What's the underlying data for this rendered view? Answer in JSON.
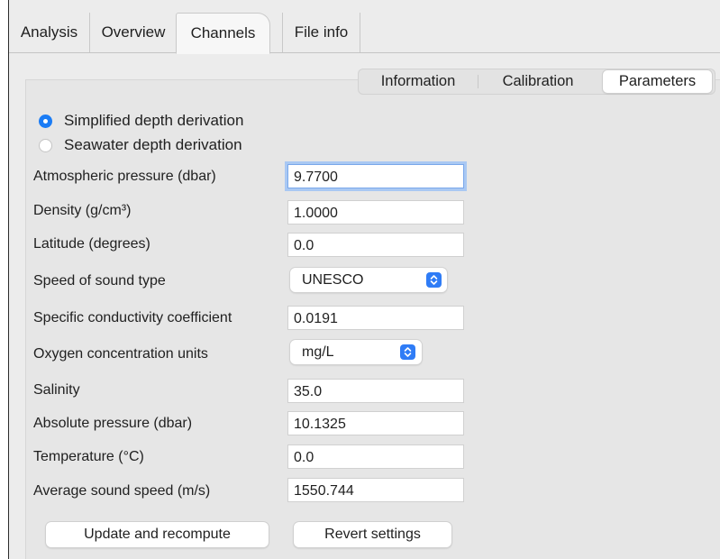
{
  "tabs": [
    "Analysis",
    "Overview",
    "Channels",
    "File info"
  ],
  "active_tab": "Channels",
  "subtabs": [
    "Information",
    "Calibration",
    "Parameters"
  ],
  "active_subtab": "Parameters",
  "depth": {
    "options": [
      "Simplified depth derivation",
      "Seawater depth derivation"
    ],
    "selected": "Simplified depth derivation"
  },
  "fields": {
    "atmospheric_pressure": {
      "label": "Atmospheric pressure (dbar)",
      "value": "9.7700"
    },
    "density": {
      "label": "Density (g/cm³)",
      "value": "1.0000"
    },
    "latitude": {
      "label": "Latitude (degrees)",
      "value": "0.0"
    },
    "speed_of_sound_type": {
      "label": "Speed of sound type",
      "value": "UNESCO"
    },
    "specific_conductivity": {
      "label": "Specific conductivity coefficient",
      "value": "0.0191"
    },
    "oxygen_units": {
      "label": "Oxygen concentration units",
      "value": "mg/L"
    },
    "salinity": {
      "label": "Salinity",
      "value": "35.0"
    },
    "absolute_pressure": {
      "label": "Absolute pressure (dbar)",
      "value": "10.1325"
    },
    "temperature": {
      "label": "Temperature (°C)",
      "value": "0.0"
    },
    "average_sound_speed": {
      "label": "Average sound speed (m/s)",
      "value": "1550.744"
    }
  },
  "buttons": {
    "update": "Update and recompute",
    "revert": "Revert settings"
  },
  "colors": {
    "accent": "#1a7cf5",
    "focus_ring": "#a9c8f3",
    "window_bg": "#ececec"
  }
}
